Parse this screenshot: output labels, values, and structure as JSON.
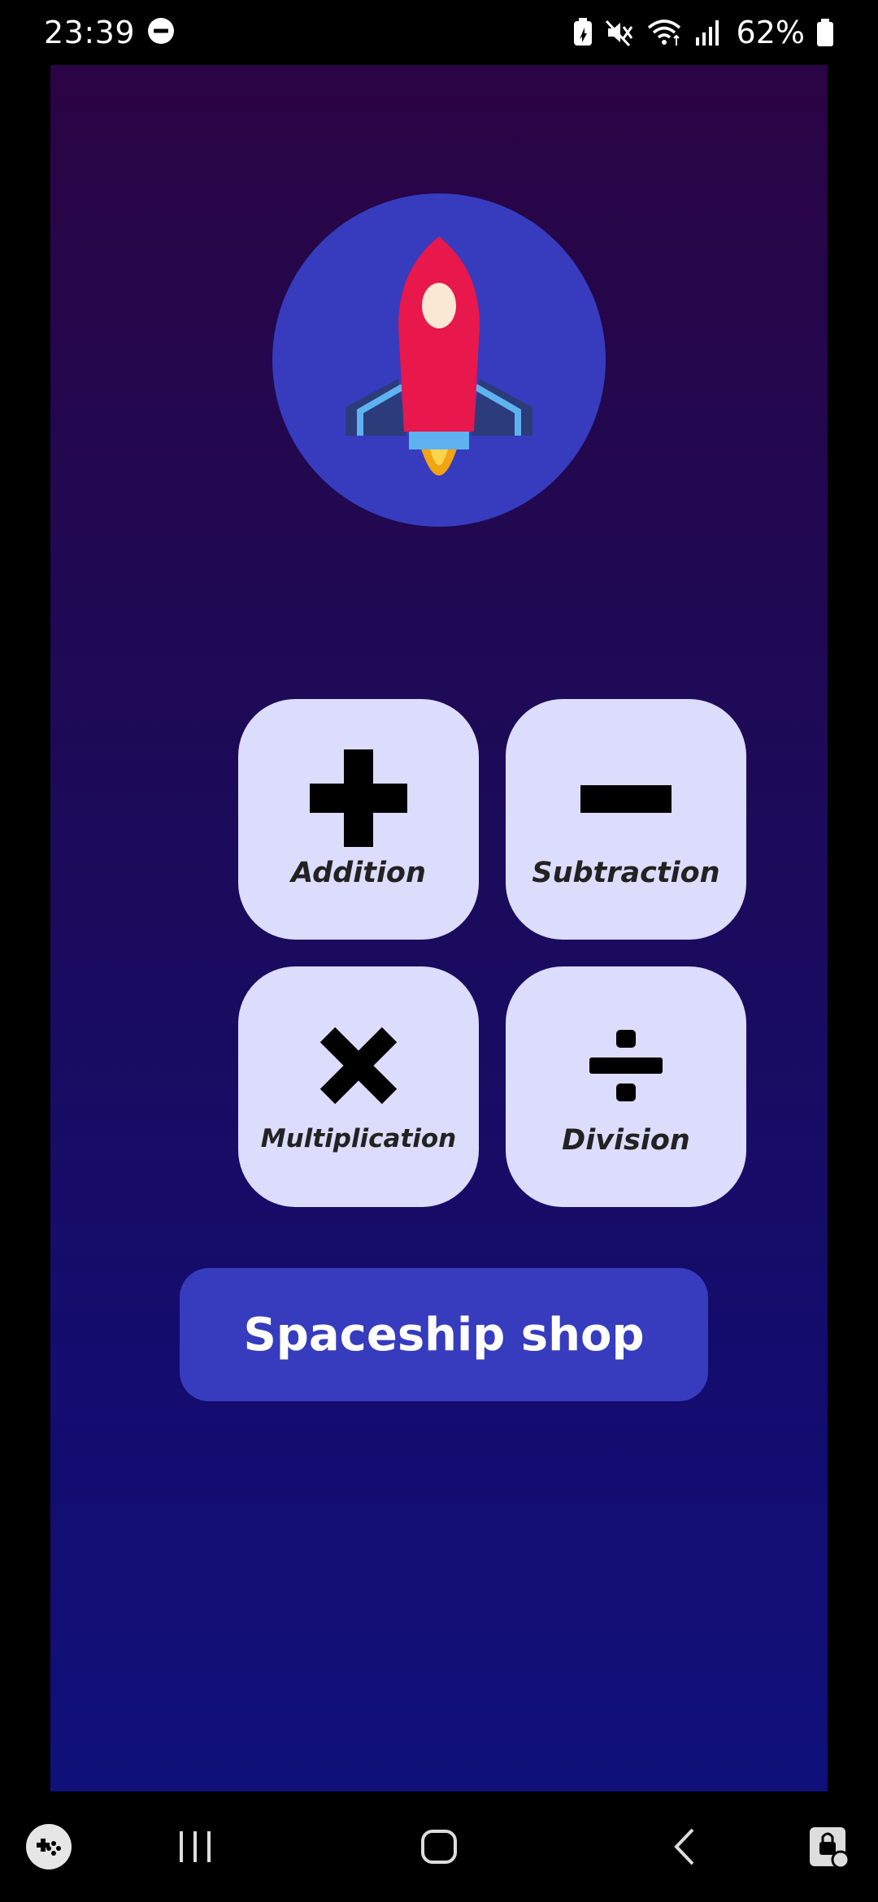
{
  "status_bar": {
    "time": "23:39",
    "battery_percent": "62%",
    "icons": [
      "do-not-disturb-icon",
      "battery-saver-icon",
      "mute-icon",
      "wifi-icon",
      "signal-icon",
      "battery-icon"
    ]
  },
  "app": {
    "logo_icon": "rocket-icon",
    "operations": [
      {
        "label": "Addition",
        "icon": "plus-icon"
      },
      {
        "label": "Subtraction",
        "icon": "minus-icon"
      },
      {
        "label": "Multiplication",
        "icon": "times-icon"
      },
      {
        "label": "Division",
        "icon": "divide-icon"
      }
    ],
    "shop_button_label": "Spaceship shop",
    "colors": {
      "background_top": "#2a0444",
      "background_bottom": "#10107a",
      "accent": "#363cbd",
      "card": "#dcdcfc",
      "rocket_body": "#e8174c"
    }
  },
  "nav_bar": {
    "items": [
      "game-launcher-icon",
      "recent-apps-icon",
      "home-icon",
      "back-icon",
      "lock-touch-icon"
    ]
  }
}
